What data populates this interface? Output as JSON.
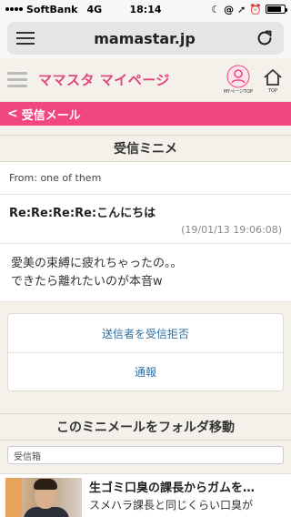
{
  "status_bar": {
    "carrier": "SoftBank",
    "network": "4G",
    "time": "18:14",
    "icons": [
      "moon-icon",
      "at-icon",
      "location-icon",
      "alarm-icon",
      "battery-icon"
    ],
    "battery_level": 0.85
  },
  "browser": {
    "url": "mamastar.jp"
  },
  "header": {
    "title": "ママスタ マイページ",
    "mypage_top_label": "MYページTOP",
    "top_label": "TOP"
  },
  "back_bar": {
    "label": "受信メール"
  },
  "message": {
    "section_title": "受信ミニメ",
    "from": "From: one of them",
    "subject": "Re:Re:Re:Re:こんにちは",
    "date": "(19/01/13 19:06:08)",
    "body_line1": "愛美の束縛に疲れちゃったの。。",
    "body_line2": "できたら離れたいのが本音w"
  },
  "actions": {
    "block_sender": "送信者を受信拒否",
    "report": "通報"
  },
  "folder": {
    "title": "このミニメールをフォルダ移動",
    "select_value": "受信箱"
  },
  "ad": {
    "title": "生ゴミ口臭の課長からガムを…",
    "desc": "スメハラ課長と同じくらい口臭が"
  },
  "colors": {
    "accent_pink": "#f1477f",
    "title_pink": "#e0457b",
    "link_blue": "#2f6ea0"
  }
}
